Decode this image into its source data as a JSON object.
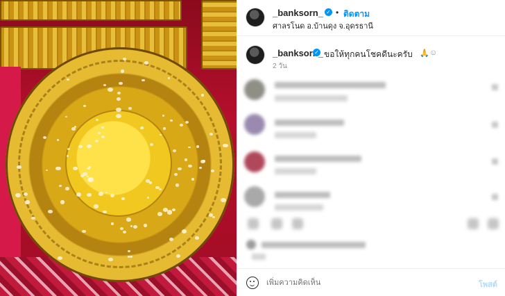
{
  "post": {
    "author": "_banksorn_",
    "follow_label": "ติดตาม",
    "separator": "•",
    "verified_mark": "✓",
    "location": "ศาลรโนด อ.บ้านดุง จ.อุดรธานี",
    "caption": {
      "username": "_banksorn_",
      "text": "ขอให้ทุกคนโชคดีนะครับ",
      "emoji_1": "🙏",
      "emoji_2": "☺",
      "time": "2 วัน"
    }
  },
  "icons": {
    "verified": "verified-badge-icon",
    "emoji": "smiley-face-icon",
    "like": "heart-icon",
    "comment": "comment-bubble-icon",
    "share": "paper-plane-icon",
    "save": "bookmark-icon"
  },
  "composer": {
    "placeholder": "เพิ่มความคิดเห็น",
    "post_label": "โพสต์"
  },
  "colors": {
    "link_blue": "#0095f6",
    "post_disabled": "#b3dbff",
    "verified_blue": "#0095f6"
  }
}
